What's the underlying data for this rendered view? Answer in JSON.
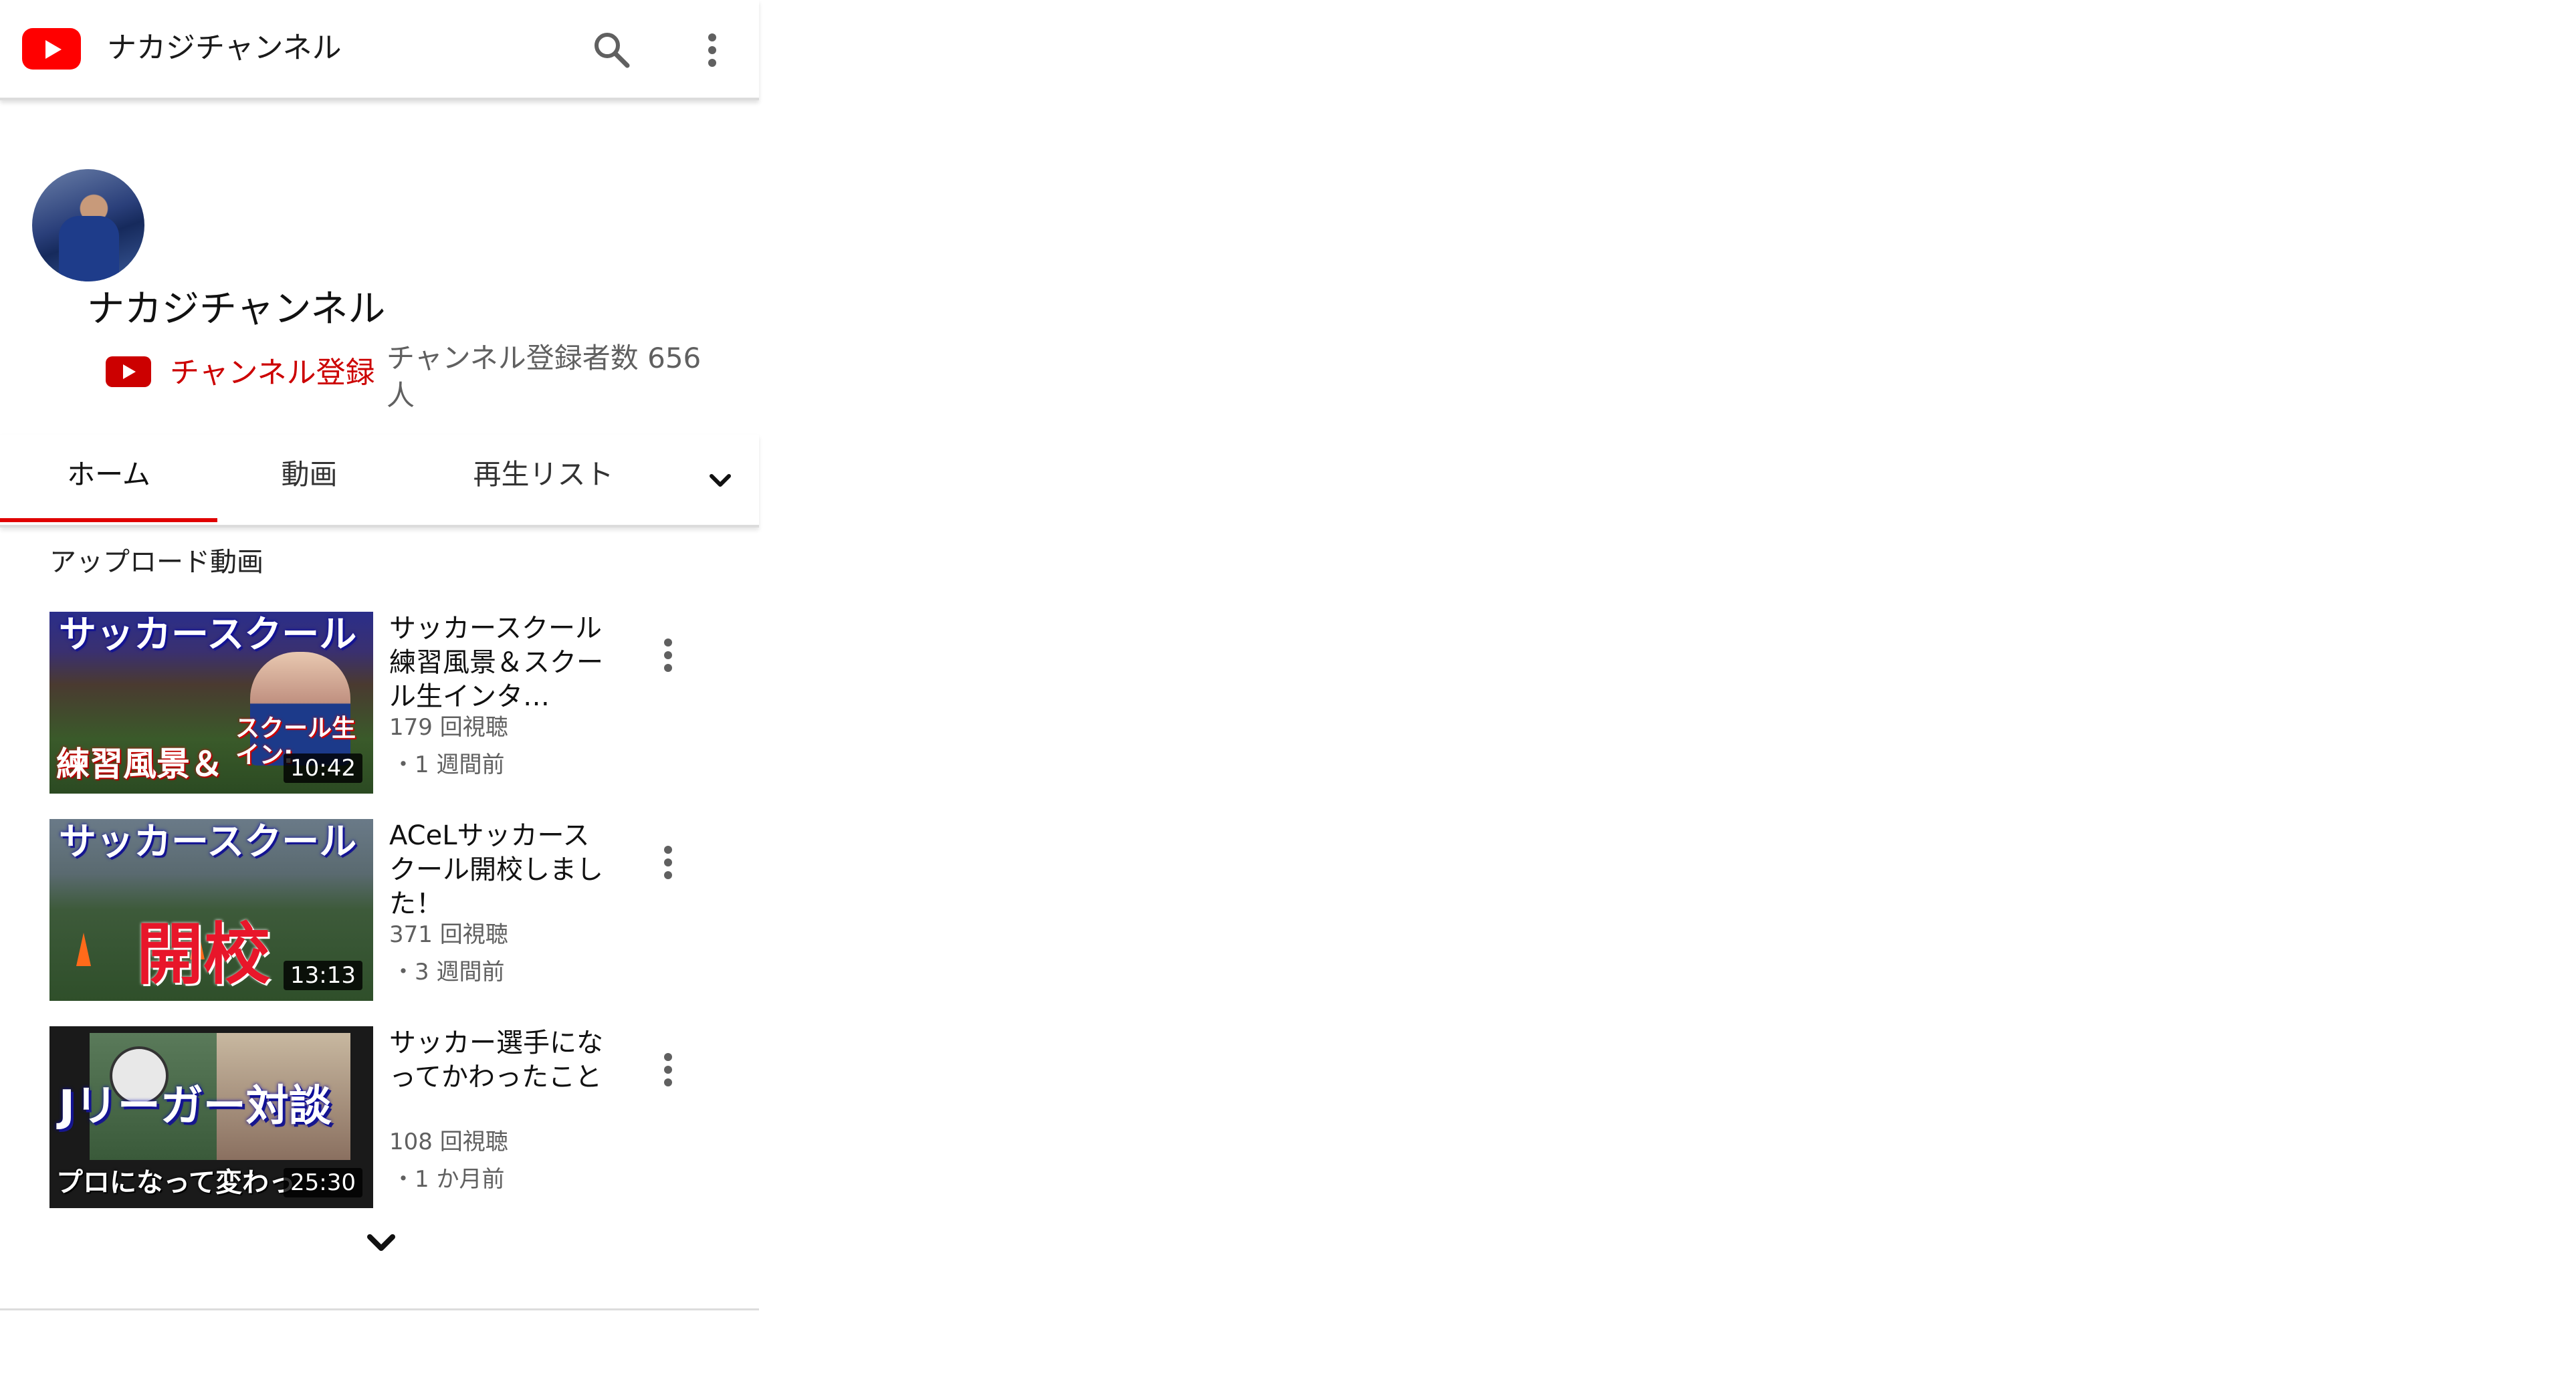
{
  "app_bar": {
    "title": "ナカジチャンネル",
    "logo_icon": "youtube-logo-icon",
    "search_icon": "search-icon",
    "more_icon": "more-vert-icon"
  },
  "channel": {
    "name": "ナカジチャンネル",
    "subscribe_label": "チャンネル登録",
    "subscriber_count": "チャンネル登録者数 656 人"
  },
  "tabs": {
    "items": [
      "ホーム",
      "動画",
      "再生リスト"
    ],
    "selected": "ホーム",
    "expand_icon": "chevron-down-icon"
  },
  "section": {
    "title": "アップロード動画"
  },
  "videos": [
    {
      "title": "サッカースクール練習風景＆スクール生インタ…",
      "views": "179 回視聴",
      "age": "・1 週間前",
      "duration": "10:42",
      "thumb_top": "サッカースクール",
      "thumb_bottom": "練習風景＆",
      "thumb_extra": "スクール生",
      "thumb_extra2": "イン:"
    },
    {
      "title": "ACeLサッカースクール開校しました！",
      "views": "371 回視聴",
      "age": "・3 週間前",
      "duration": "13:13",
      "thumb_top": "サッカースクール",
      "thumb_bottom": "開校"
    },
    {
      "title": "サッカー選手になってかわったこと",
      "views": "108 回視聴",
      "age": "・1 か月前",
      "duration": "25:30",
      "thumb_top": "Jリーガー対談",
      "thumb_bottom": "プロになって変わっ"
    }
  ],
  "colors": {
    "brand_red": "#ff0000",
    "subscribe_red": "#cc0000",
    "tab_indicator": "#e00000",
    "secondary_text": "#606060"
  }
}
